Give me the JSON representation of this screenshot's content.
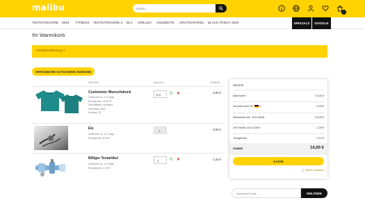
{
  "header": {
    "logo": "malibu",
    "search_placeholder": "Suche...",
    "icons": [
      "info-icon",
      "globe-icon",
      "user-icon",
      "heart-icon",
      "cart-icon"
    ],
    "cart_count": "1",
    "accent_color": "#ffd200"
  },
  "nav": {
    "items": [
      "Testkategorie",
      "MHD",
      "Fitness",
      "Testkategorie 2",
      "BLA",
      "Grillen",
      "Angebote",
      "Gratisartikel",
      "Black Friday 2020"
    ],
    "specials": "Specials",
    "google": "Google"
  },
  "page": {
    "title": "Ihr Warenkorb",
    "notice": "Höchstbestellmenge 1",
    "voucher_button": "Verfügbare Gutscheine anzeigen"
  },
  "table": {
    "headers": {
      "article": "Artikel",
      "quantity": "Anzahl",
      "sum": "Summe"
    }
  },
  "items": [
    {
      "name": "Customizer Wunschdruck",
      "details": [
        "Lieferzeit ca. 1-4 Tage",
        "Einzelpreis: 15,00 €",
        "Schriftfarbe: schwarz",
        "Schriftart: wolf",
        "Upload: [?]"
      ],
      "qty": "0,3",
      "price": "5,00 €"
    },
    {
      "name": "Eis",
      "details": [
        "Lieferzeit ca. 3-4 Tage",
        "Einzelpreis: 8,00 €"
      ],
      "qty": "1",
      "price": "8,00 €"
    },
    {
      "name": "Billiger Testartikel",
      "details": [
        "Lieferzeit ca. 3-4 Tage",
        "Einzelpreis: 1,00 €"
      ],
      "qty": "1",
      "price": "1,00 €"
    }
  ],
  "summary": {
    "title": "Summe",
    "rows": [
      {
        "label": "Warenwert",
        "value": "14,00 €"
      },
      {
        "label": "Versand nach DE",
        "value": "0,00 €"
      },
      {
        "label": "Warenwert inkl. 19% MwSt.",
        "value": "14,00 €"
      },
      {
        "label": "19% MwSt. auf 11,86 €",
        "value": "2,25 €"
      },
      {
        "label": "Trinkgebühr",
        "value": "0,14 €"
      }
    ],
    "total_label": "Summe",
    "total_value": "14,00 €",
    "checkout_button": "Kasse",
    "continue_link": "Weiter einkaufen"
  },
  "coupon": {
    "placeholder": "Gutschein-Code",
    "button": "Einlösen"
  }
}
